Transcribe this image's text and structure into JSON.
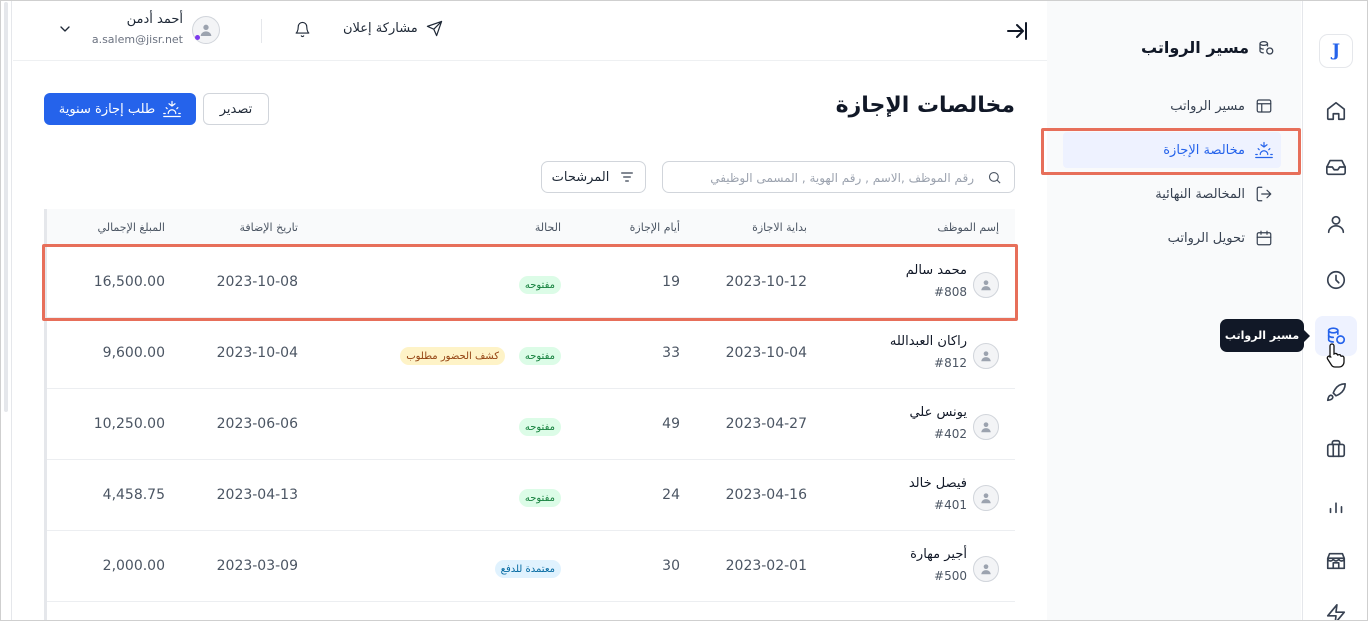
{
  "app": {
    "logo_letter": "J",
    "collapse_label": "→|"
  },
  "topbar": {
    "share_label": "مشاركة إعلان",
    "user_name": "أحمد أدمن",
    "user_email": "a.salem@jisr.net"
  },
  "sidebar": {
    "title": "مسير الرواتب",
    "items": [
      {
        "label": "مسير الرواتب",
        "icon": "table-icon"
      },
      {
        "label": "مخالصة الإجازة",
        "icon": "sunset-icon"
      },
      {
        "label": "المخالصة النهائية",
        "icon": "exit-icon"
      },
      {
        "label": "تحويل الرواتب",
        "icon": "calendar-icon"
      }
    ],
    "active_index": 1
  },
  "rail": {
    "icons": [
      "home-icon",
      "inbox-icon",
      "user-icon",
      "clock-icon",
      "coins-icon",
      "rocket-icon",
      "briefcase-icon",
      "chart-icon",
      "store-icon",
      "bolt-icon"
    ],
    "active_icon": "coins-icon",
    "tooltip": "مسير الرواتب"
  },
  "page": {
    "title": "مخالصات الإجازة",
    "export_label": "تصدير",
    "request_label": "طلب إجازة سنوية",
    "search_placeholder": "رقم الموظف ,الاسم , رقم الهوية , المسمى الوظيفي",
    "filters_label": "المرشحات"
  },
  "table": {
    "headers": {
      "employee": "إسم الموظف",
      "start": "بداية الاجازة",
      "days": "أيام الإجازة",
      "status": "الحالة",
      "added": "تاريخ الإضافة",
      "total": "المبلغ الإجمالي"
    },
    "rows": [
      {
        "name": "محمد سالم",
        "id": "#808",
        "start": "2023-10-12",
        "days": "19",
        "status": "مفتوحه",
        "extra": "",
        "added": "2023-10-08",
        "total": "16,500.00"
      },
      {
        "name": "راكان العبدالله",
        "id": "#812",
        "start": "2023-10-04",
        "days": "33",
        "status": "مفتوحه",
        "extra": "كشف الحضور مطلوب",
        "added": "2023-10-04",
        "total": "9,600.00"
      },
      {
        "name": "يونس علي",
        "id": "#402",
        "start": "2023-04-27",
        "days": "49",
        "status": "مفتوحه",
        "extra": "",
        "added": "2023-06-06",
        "total": "10,250.00"
      },
      {
        "name": "فيصل خالد",
        "id": "#401",
        "start": "2023-04-16",
        "days": "24",
        "status": "مفتوحه",
        "extra": "",
        "added": "2023-04-13",
        "total": "4,458.75"
      },
      {
        "name": "أجير مهارة",
        "id": "#500",
        "start": "2023-02-01",
        "days": "30",
        "status": "معتمدة للدفع",
        "extra": "",
        "added": "2023-03-09",
        "total": "2,000.00"
      }
    ]
  },
  "colors": {
    "accent": "#2563eb",
    "highlight": "#e76f5a",
    "open_badge_bg": "#dcfce7",
    "paid_badge_bg": "#e0f2fe",
    "warn_badge_bg": "#fef3c7"
  }
}
